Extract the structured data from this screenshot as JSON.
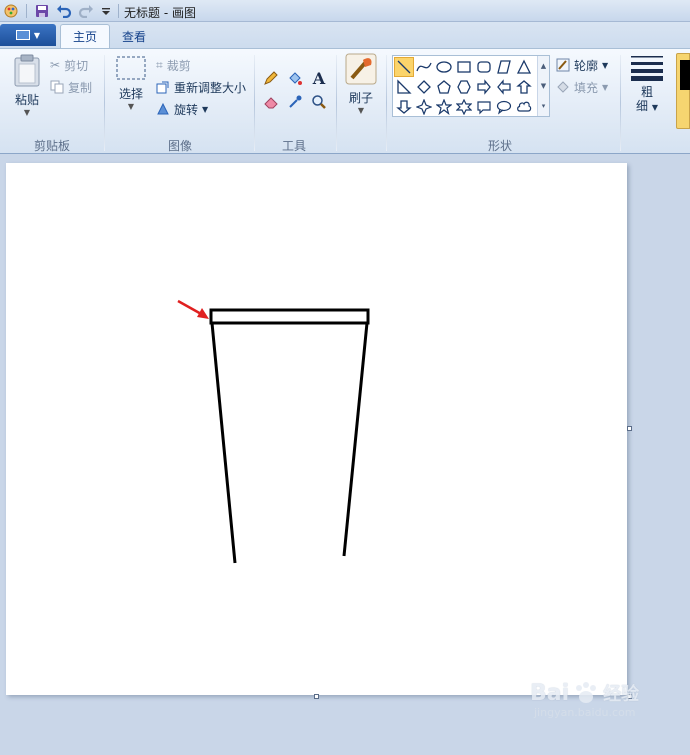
{
  "window": {
    "title": "无标题 - 画图"
  },
  "quick_access": {
    "icons": [
      "paint-app-icon",
      "save-icon",
      "undo-icon",
      "redo-icon",
      "customize-dropdown-icon"
    ]
  },
  "tabs": [
    {
      "label": "主页",
      "active": true
    },
    {
      "label": "查看",
      "active": false
    }
  ],
  "ribbon": {
    "clipboard": {
      "paste_label": "粘贴",
      "cut_label": "剪切",
      "copy_label": "复制",
      "group_label": "剪贴板"
    },
    "image": {
      "select_label": "选择",
      "crop_label": "裁剪",
      "resize_label": "重新调整大小",
      "rotate_label": "旋转",
      "group_label": "图像"
    },
    "tools": {
      "group_label": "工具"
    },
    "brushes": {
      "label": "刷子"
    },
    "shapes": {
      "outline_label": "轮廓",
      "fill_label": "填充",
      "group_label": "形状"
    },
    "size": {
      "label_line1": "粗",
      "label_line2": "细"
    }
  },
  "watermark": {
    "brand": "Bai",
    "brand2": "经验",
    "url": "jingyan.baidu.com"
  },
  "colors": {
    "accent": "#fbd46b",
    "arrow": "#e02020",
    "stroke": "#000000"
  }
}
